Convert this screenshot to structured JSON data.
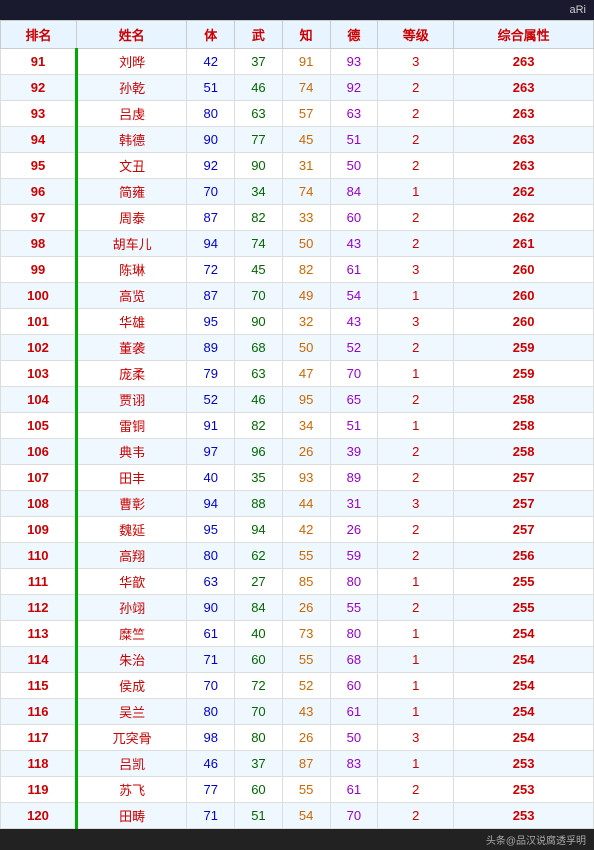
{
  "header": {
    "watermark": "aRi"
  },
  "columns": [
    "排名",
    "姓名",
    "体",
    "武",
    "知",
    "德",
    "等级",
    "综合属性"
  ],
  "rows": [
    {
      "rank": 91,
      "name": "刘晔",
      "ti": 42,
      "wu": 37,
      "zhi": 91,
      "de": 93,
      "level": 3,
      "total": 263
    },
    {
      "rank": 92,
      "name": "孙乾",
      "ti": 51,
      "wu": 46,
      "zhi": 74,
      "de": 92,
      "level": 2,
      "total": 263
    },
    {
      "rank": 93,
      "name": "吕虔",
      "ti": 80,
      "wu": 63,
      "zhi": 57,
      "de": 63,
      "level": 2,
      "total": 263
    },
    {
      "rank": 94,
      "name": "韩德",
      "ti": 90,
      "wu": 77,
      "zhi": 45,
      "de": 51,
      "level": 2,
      "total": 263
    },
    {
      "rank": 95,
      "name": "文丑",
      "ti": 92,
      "wu": 90,
      "zhi": 31,
      "de": 50,
      "level": 2,
      "total": 263
    },
    {
      "rank": 96,
      "name": "简雍",
      "ti": 70,
      "wu": 34,
      "zhi": 74,
      "de": 84,
      "level": 1,
      "total": 262
    },
    {
      "rank": 97,
      "name": "周泰",
      "ti": 87,
      "wu": 82,
      "zhi": 33,
      "de": 60,
      "level": 2,
      "total": 262
    },
    {
      "rank": 98,
      "name": "胡车儿",
      "ti": 94,
      "wu": 74,
      "zhi": 50,
      "de": 43,
      "level": 2,
      "total": 261
    },
    {
      "rank": 99,
      "name": "陈琳",
      "ti": 72,
      "wu": 45,
      "zhi": 82,
      "de": 61,
      "level": 3,
      "total": 260
    },
    {
      "rank": 100,
      "name": "高览",
      "ti": 87,
      "wu": 70,
      "zhi": 49,
      "de": 54,
      "level": 1,
      "total": 260
    },
    {
      "rank": 101,
      "name": "华雄",
      "ti": 95,
      "wu": 90,
      "zhi": 32,
      "de": 43,
      "level": 3,
      "total": 260
    },
    {
      "rank": 102,
      "name": "董袭",
      "ti": 89,
      "wu": 68,
      "zhi": 50,
      "de": 52,
      "level": 2,
      "total": 259
    },
    {
      "rank": 103,
      "name": "庞柔",
      "ti": 79,
      "wu": 63,
      "zhi": 47,
      "de": 70,
      "level": 1,
      "total": 259
    },
    {
      "rank": 104,
      "name": "贾诩",
      "ti": 52,
      "wu": 46,
      "zhi": 95,
      "de": 65,
      "level": 2,
      "total": 258
    },
    {
      "rank": 105,
      "name": "雷铜",
      "ti": 91,
      "wu": 82,
      "zhi": 34,
      "de": 51,
      "level": 1,
      "total": 258
    },
    {
      "rank": 106,
      "name": "典韦",
      "ti": 97,
      "wu": 96,
      "zhi": 26,
      "de": 39,
      "level": 2,
      "total": 258
    },
    {
      "rank": 107,
      "name": "田丰",
      "ti": 40,
      "wu": 35,
      "zhi": 93,
      "de": 89,
      "level": 2,
      "total": 257
    },
    {
      "rank": 108,
      "name": "曹彰",
      "ti": 94,
      "wu": 88,
      "zhi": 44,
      "de": 31,
      "level": 3,
      "total": 257
    },
    {
      "rank": 109,
      "name": "魏延",
      "ti": 95,
      "wu": 94,
      "zhi": 42,
      "de": 26,
      "level": 2,
      "total": 257
    },
    {
      "rank": 110,
      "name": "高翔",
      "ti": 80,
      "wu": 62,
      "zhi": 55,
      "de": 59,
      "level": 2,
      "total": 256
    },
    {
      "rank": 111,
      "name": "华歆",
      "ti": 63,
      "wu": 27,
      "zhi": 85,
      "de": 80,
      "level": 1,
      "total": 255
    },
    {
      "rank": 112,
      "name": "孙翊",
      "ti": 90,
      "wu": 84,
      "zhi": 26,
      "de": 55,
      "level": 2,
      "total": 255
    },
    {
      "rank": 113,
      "name": "糜竺",
      "ti": 61,
      "wu": 40,
      "zhi": 73,
      "de": 80,
      "level": 1,
      "total": 254
    },
    {
      "rank": 114,
      "name": "朱治",
      "ti": 71,
      "wu": 60,
      "zhi": 55,
      "de": 68,
      "level": 1,
      "total": 254
    },
    {
      "rank": 115,
      "name": "侯成",
      "ti": 70,
      "wu": 72,
      "zhi": 52,
      "de": 60,
      "level": 1,
      "total": 254
    },
    {
      "rank": 116,
      "name": "吴兰",
      "ti": 80,
      "wu": 70,
      "zhi": 43,
      "de": 61,
      "level": 1,
      "total": 254
    },
    {
      "rank": 117,
      "name": "兀突骨",
      "ti": 98,
      "wu": 80,
      "zhi": 26,
      "de": 50,
      "level": 3,
      "total": 254
    },
    {
      "rank": 118,
      "name": "吕凯",
      "ti": 46,
      "wu": 37,
      "zhi": 87,
      "de": 83,
      "level": 1,
      "total": 253
    },
    {
      "rank": 119,
      "name": "苏飞",
      "ti": 77,
      "wu": 60,
      "zhi": 55,
      "de": 61,
      "level": 2,
      "total": 253
    },
    {
      "rank": 120,
      "name": "田畴",
      "ti": 71,
      "wu": 51,
      "zhi": 54,
      "de": 70,
      "level": 2,
      "total": 253
    }
  ],
  "footer": {
    "brand": "头条@品汉说腐透孚明"
  }
}
